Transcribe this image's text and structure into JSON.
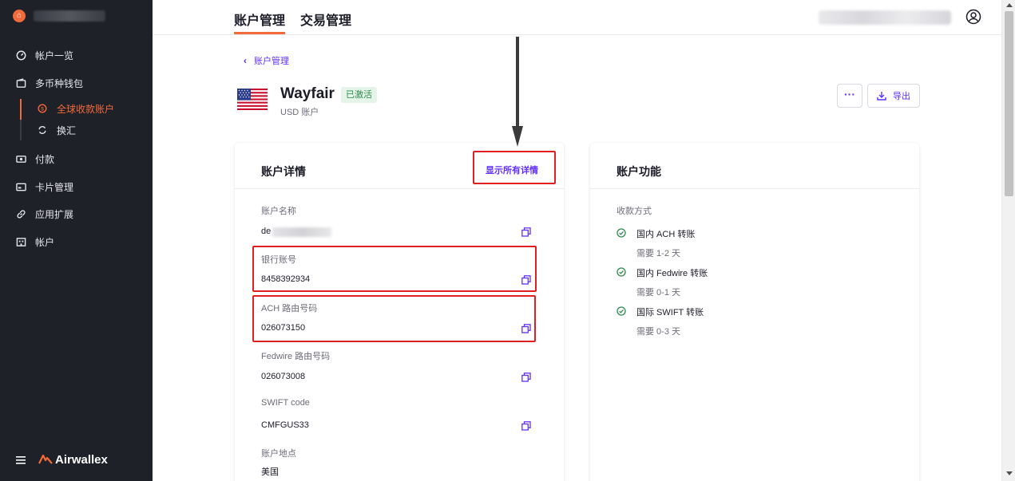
{
  "sidebar": {
    "items": [
      {
        "label": "帐户一览",
        "icon": "dashboard-icon"
      },
      {
        "label": "多币种钱包",
        "icon": "wallet-icon"
      },
      {
        "label": "付款",
        "icon": "payment-icon"
      },
      {
        "label": "卡片管理",
        "icon": "card-icon"
      },
      {
        "label": "应用扩展",
        "icon": "link-icon"
      },
      {
        "label": "帐户",
        "icon": "building-icon"
      }
    ],
    "sub_items": [
      {
        "label": "全球收款账户",
        "icon": "global-account-icon",
        "active": true
      },
      {
        "label": "换汇",
        "icon": "exchange-icon",
        "active": false
      }
    ],
    "brand_text": "Airwallex",
    "accent_color": "#f26a3a"
  },
  "header": {
    "tabs": [
      {
        "label": "账户管理",
        "active": true
      },
      {
        "label": "交易管理",
        "active": false
      }
    ],
    "user_icon": "user-circle-icon"
  },
  "breadcrumb": {
    "label": "账户管理"
  },
  "account": {
    "title": "Wayfair",
    "status": "已激活",
    "subtitle": "USD 账户",
    "flag": "us-flag-icon",
    "export_label": "导出",
    "more_label": "···"
  },
  "details_card": {
    "title": "账户详情",
    "show_all_label": "显示所有详情",
    "fields": [
      {
        "label": "账户名称",
        "value": "de"
      },
      {
        "label": "银行账号",
        "value": "8458392934"
      },
      {
        "label": "ACH 路由号码",
        "value": "026073150"
      },
      {
        "label": "Fedwire 路由号码",
        "value": "026073008"
      },
      {
        "label": "SWIFT code",
        "value": "CMFGUS33"
      },
      {
        "label": "账户地点",
        "value": "美国"
      }
    ]
  },
  "features_card": {
    "title": "账户功能",
    "section_label": "收款方式",
    "methods": [
      {
        "name": "国内 ACH 转账",
        "time": "需要 1-2 天"
      },
      {
        "name": "国内 Fedwire 转账",
        "time": "需要 0-1 天"
      },
      {
        "name": "国际 SWIFT 转账",
        "time": "需要 0-3 天"
      }
    ]
  },
  "colors": {
    "primary": "#612fff",
    "success": "#2f8a4f",
    "annotation": "#e02020"
  }
}
